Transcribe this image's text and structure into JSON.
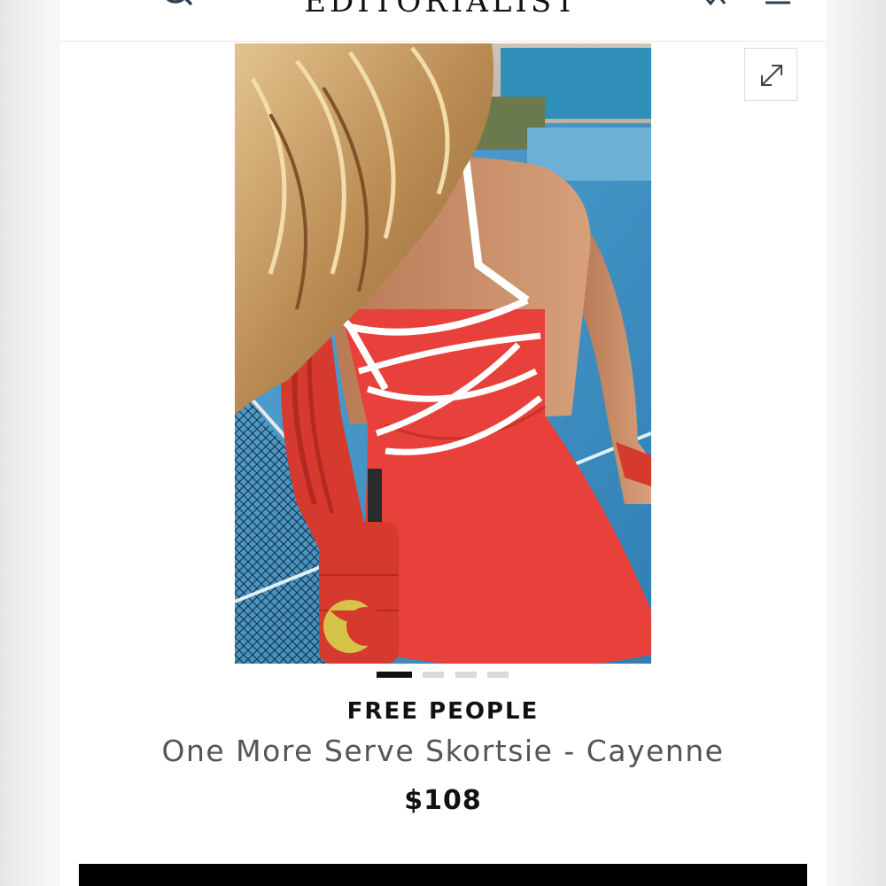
{
  "header": {
    "logo_text": "EDITORIALIST",
    "icons": [
      "menu-icon",
      "search-icon",
      "cart-icon",
      "account-icon"
    ]
  },
  "gallery": {
    "image_alt": "Woman in red tennis dress with white strappy back on tennis court",
    "slide_count": 4,
    "active_slide": 1,
    "expand_icon": "expand-icon"
  },
  "product": {
    "brand": "FREE PEOPLE",
    "name": "One More Serve Skortsie - Cayenne",
    "price": "$108"
  },
  "colors": {
    "accent": "#000000",
    "dress": "#e8403a",
    "court": "#3f8fc0"
  }
}
